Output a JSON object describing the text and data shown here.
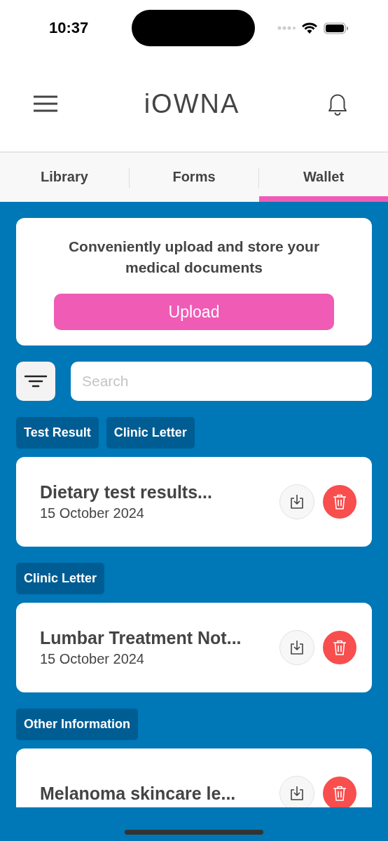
{
  "status_bar": {
    "time": "10:37"
  },
  "header": {
    "logo": "iOWNA"
  },
  "tabs": [
    {
      "label": "Library",
      "selected": false
    },
    {
      "label": "Forms",
      "selected": false
    },
    {
      "label": "Wallet",
      "selected": true
    }
  ],
  "upload_card": {
    "text": "Conveniently upload and store your medical documents",
    "button": "Upload"
  },
  "search": {
    "placeholder": "Search"
  },
  "documents": [
    {
      "tags": [
        "Test Result",
        "Clinic Letter"
      ],
      "title": "Dietary test results...",
      "date": "15 October 2024"
    },
    {
      "tags": [
        "Clinic Letter"
      ],
      "title": "Lumbar Treatment Not...",
      "date": "15 October 2024"
    },
    {
      "tags": [
        "Other Information"
      ],
      "title": "Melanoma skincare le..."
    }
  ]
}
